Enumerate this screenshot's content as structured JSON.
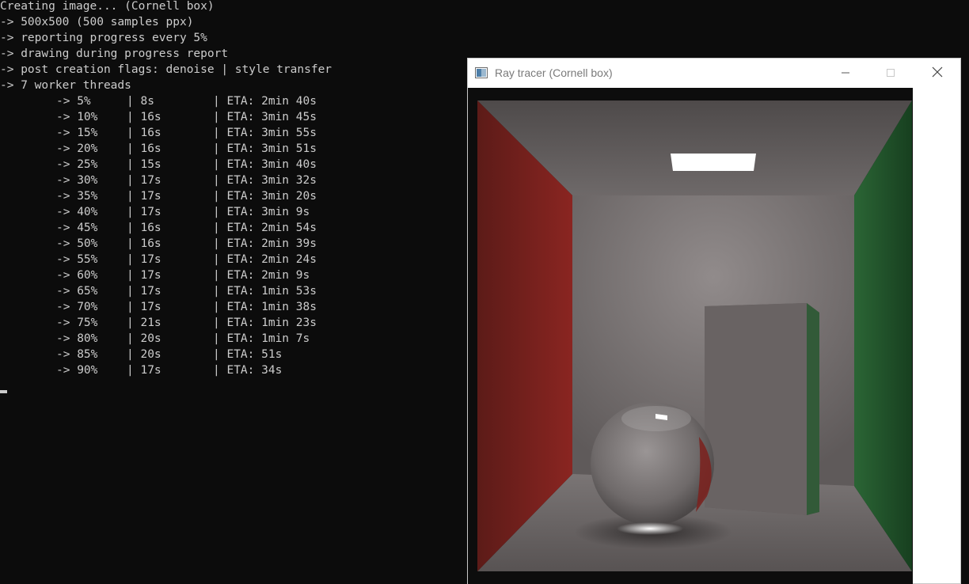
{
  "console": {
    "header_lines": [
      "Creating image... (Cornell box)",
      "-> 500x500 (500 samples ppx)",
      "-> reporting progress every 5%",
      "-> drawing during progress report",
      "-> post creation flags: denoise | style transfer",
      "-> 7 worker threads"
    ],
    "progress_rows": [
      {
        "pct": "-> 5%",
        "time": "| 8s",
        "eta": "| ETA: 2min 40s"
      },
      {
        "pct": "-> 10%",
        "time": "| 16s",
        "eta": "| ETA: 3min 45s"
      },
      {
        "pct": "-> 15%",
        "time": "| 16s",
        "eta": "| ETA: 3min 55s"
      },
      {
        "pct": "-> 20%",
        "time": "| 16s",
        "eta": "| ETA: 3min 51s"
      },
      {
        "pct": "-> 25%",
        "time": "| 15s",
        "eta": "| ETA: 3min 40s"
      },
      {
        "pct": "-> 30%",
        "time": "| 17s",
        "eta": "| ETA: 3min 32s"
      },
      {
        "pct": "-> 35%",
        "time": "| 17s",
        "eta": "| ETA: 3min 20s"
      },
      {
        "pct": "-> 40%",
        "time": "| 17s",
        "eta": "| ETA: 3min 9s"
      },
      {
        "pct": "-> 45%",
        "time": "| 16s",
        "eta": "| ETA: 2min 54s"
      },
      {
        "pct": "-> 50%",
        "time": "| 16s",
        "eta": "| ETA: 2min 39s"
      },
      {
        "pct": "-> 55%",
        "time": "| 17s",
        "eta": "| ETA: 2min 24s"
      },
      {
        "pct": "-> 60%",
        "time": "| 17s",
        "eta": "| ETA: 2min 9s"
      },
      {
        "pct": "-> 65%",
        "time": "| 17s",
        "eta": "| ETA: 1min 53s"
      },
      {
        "pct": "-> 70%",
        "time": "| 17s",
        "eta": "| ETA: 1min 38s"
      },
      {
        "pct": "-> 75%",
        "time": "| 21s",
        "eta": "| ETA: 1min 23s"
      },
      {
        "pct": "-> 80%",
        "time": "| 20s",
        "eta": "| ETA: 1min 7s"
      },
      {
        "pct": "-> 85%",
        "time": "| 20s",
        "eta": "| ETA: 51s"
      },
      {
        "pct": "-> 90%",
        "time": "| 17s",
        "eta": "| ETA: 34s"
      }
    ]
  },
  "window": {
    "title": "Ray tracer (Cornell box)",
    "icons": {
      "app": "app-window-icon",
      "minimize": "minimize-icon",
      "maximize": "maximize-icon",
      "close": "close-icon"
    }
  },
  "scene": {
    "name": "Cornell box",
    "colors": {
      "left_wall": "#8a2320",
      "right_wall": "#215a2c",
      "walls": "#7c7777",
      "light": "#ffffff",
      "background": "#0c0c0c"
    }
  }
}
